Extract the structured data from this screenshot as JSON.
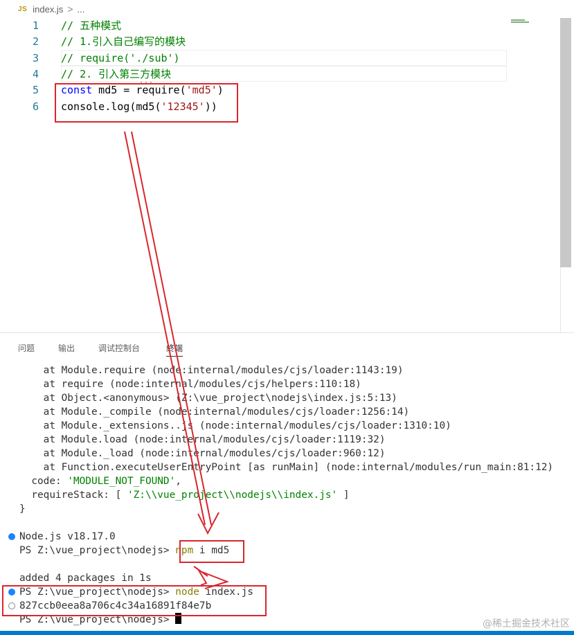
{
  "breadcrumb": {
    "icon_label": "JS",
    "file": "index.js",
    "separator": ">",
    "rest": "..."
  },
  "editor": {
    "lines": [
      {
        "num": "1",
        "parts": [
          {
            "t": "// 五种模式",
            "c": "comment"
          }
        ]
      },
      {
        "num": "2",
        "parts": [
          {
            "t": "// 1.引入自己编写的模块",
            "c": "comment"
          }
        ]
      },
      {
        "num": "3",
        "parts": [
          {
            "t": "// require('./sub')",
            "c": "comment"
          }
        ]
      },
      {
        "num": "4",
        "parts": [
          {
            "t": "// 2. 引入第三方模块",
            "c": "comment"
          }
        ]
      },
      {
        "num": "5",
        "parts": [
          {
            "t": "const",
            "c": "kw"
          },
          {
            "t": " md5 = require(",
            "c": "plain"
          },
          {
            "t": "'md5'",
            "c": "str"
          },
          {
            "t": ")",
            "c": "plain"
          }
        ]
      },
      {
        "num": "6",
        "parts": [
          {
            "t": "console.log(md5(",
            "c": "plain"
          },
          {
            "t": "'12345'",
            "c": "str"
          },
          {
            "t": "))",
            "c": "plain"
          }
        ]
      }
    ]
  },
  "panel": {
    "tabs": [
      "问题",
      "输出",
      "调试控制台",
      "终端"
    ],
    "active_tab": "终端"
  },
  "terminal": {
    "lines": [
      {
        "marker": "",
        "parts": [
          {
            "t": "    at Module.require (node:internal/modules/cjs/loader:1143:19)",
            "c": "plain"
          }
        ]
      },
      {
        "marker": "",
        "parts": [
          {
            "t": "    at require (node:internal/modules/cjs/helpers:110:18)",
            "c": "plain"
          }
        ]
      },
      {
        "marker": "",
        "parts": [
          {
            "t": "    at Object.<anonymous> (Z:\\vue_project\\nodejs\\index.js:5:13)",
            "c": "plain"
          }
        ]
      },
      {
        "marker": "",
        "parts": [
          {
            "t": "    at Module._compile (node:internal/modules/cjs/loader:1256:14)",
            "c": "plain"
          }
        ]
      },
      {
        "marker": "",
        "parts": [
          {
            "t": "    at Module._extensions..js (node:internal/modules/cjs/loader:1310:10)",
            "c": "plain"
          }
        ]
      },
      {
        "marker": "",
        "parts": [
          {
            "t": "    at Module.load (node:internal/modules/cjs/loader:1119:32)",
            "c": "plain"
          }
        ]
      },
      {
        "marker": "",
        "parts": [
          {
            "t": "    at Module._load (node:internal/modules/cjs/loader:960:12)",
            "c": "plain"
          }
        ]
      },
      {
        "marker": "",
        "parts": [
          {
            "t": "    at Function.executeUserEntryPoint [as runMain] (node:internal/modules/run_main:81:12)",
            "c": "plain"
          }
        ]
      },
      {
        "marker": "",
        "parts": [
          {
            "t": "  code: ",
            "c": "plain"
          },
          {
            "t": "'MODULE_NOT_FOUND'",
            "c": "green"
          },
          {
            "t": ",",
            "c": "plain"
          }
        ]
      },
      {
        "marker": "",
        "parts": [
          {
            "t": "  requireStack: [ ",
            "c": "plain"
          },
          {
            "t": "'Z:\\\\vue_project\\\\nodejs\\\\index.js'",
            "c": "green"
          },
          {
            "t": " ]",
            "c": "plain"
          }
        ]
      },
      {
        "marker": "",
        "parts": [
          {
            "t": "}",
            "c": "plain"
          }
        ]
      },
      {
        "marker": "",
        "parts": [
          {
            "t": "",
            "c": "plain"
          }
        ]
      },
      {
        "marker": "blue",
        "parts": [
          {
            "t": "Node.js v18.17.0",
            "c": "plain"
          }
        ]
      },
      {
        "marker": "",
        "parts": [
          {
            "t": "PS Z:\\vue_project\\nodejs> ",
            "c": "plain"
          },
          {
            "t": "npm",
            "c": "yellow"
          },
          {
            "t": " i md5",
            "c": "plain"
          }
        ]
      },
      {
        "marker": "",
        "parts": [
          {
            "t": "",
            "c": "plain"
          }
        ]
      },
      {
        "marker": "",
        "parts": [
          {
            "t": "added 4 packages in 1s",
            "c": "plain"
          }
        ]
      },
      {
        "marker": "blue",
        "parts": [
          {
            "t": "PS Z:\\vue_project\\nodejs> ",
            "c": "plain"
          },
          {
            "t": "node",
            "c": "yellow"
          },
          {
            "t": " index.js",
            "c": "plain"
          }
        ]
      },
      {
        "marker": "empty",
        "parts": [
          {
            "t": "827ccb0eea8a706c4c34a16891f84e7b",
            "c": "plain"
          }
        ]
      },
      {
        "marker": "",
        "parts": [
          {
            "t": "PS Z:\\vue_project\\nodejs> ",
            "c": "plain"
          }
        ],
        "cursor": true
      }
    ]
  },
  "watermark": "@稀土掘金技术社区",
  "colors": {
    "highlight": "#d9262d",
    "accent": "#007acc"
  }
}
